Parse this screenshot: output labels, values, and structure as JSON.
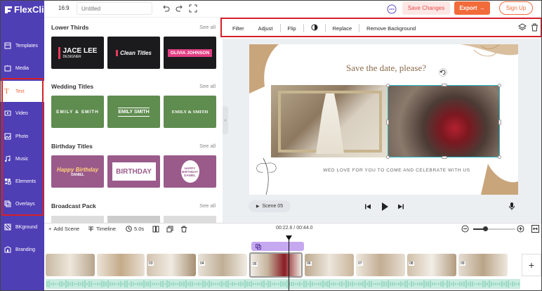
{
  "app": {
    "logo": "FlexClip",
    "aspect_ratio": "16:9",
    "title_placeholder": "Untitled"
  },
  "header": {
    "save_changes": "Save Changes",
    "export": "Export",
    "sign_up": "Sign Up"
  },
  "sidebar": {
    "items": [
      {
        "label": "Templates",
        "icon": "template-icon"
      },
      {
        "label": "Media",
        "icon": "media-icon"
      },
      {
        "label": "Text",
        "icon": "text-icon",
        "active": true
      },
      {
        "label": "Video",
        "icon": "video-icon"
      },
      {
        "label": "Photo",
        "icon": "photo-icon"
      },
      {
        "label": "Music",
        "icon": "music-icon"
      },
      {
        "label": "Elements",
        "icon": "elements-icon"
      },
      {
        "label": "Overlays",
        "icon": "overlays-icon"
      },
      {
        "label": "BKground",
        "icon": "background-icon"
      },
      {
        "label": "Branding",
        "icon": "branding-icon"
      }
    ]
  },
  "panel": {
    "sections": [
      {
        "title": "Lower Thirds",
        "see_all": "See all",
        "thumbs": [
          {
            "line1": "JACE LEE",
            "line2": "DESIGNER",
            "color": "#1b1b1d"
          },
          {
            "line1": "Clean Titles",
            "line2": "",
            "color": "#1b1b1d"
          },
          {
            "line1": "OLIVIA JOHNSON",
            "line2": "",
            "color": "#1b1b1d"
          }
        ]
      },
      {
        "title": "Wedding Titles",
        "see_all": "See all",
        "thumbs": [
          {
            "line1": "EMILY & SMITH",
            "line2": "",
            "color": "#5f8c4f"
          },
          {
            "line1": "EMILY SMITH",
            "line2": "",
            "color": "#5f8c4f"
          },
          {
            "line1": "EMILY & SMITH",
            "line2": "",
            "color": "#5f8c4f"
          }
        ]
      },
      {
        "title": "Birthday Titles",
        "see_all": "See all",
        "thumbs": [
          {
            "line1": "Happy Birthday",
            "line2": "DANIEL",
            "color": "#9a5b8b"
          },
          {
            "line1": "BIRTHDAY",
            "line2": "",
            "color": "#9a5b8b"
          },
          {
            "line1": "HAPPY BIRTHDAY",
            "line2": "DANIEL",
            "color": "#9a5b8b"
          }
        ]
      },
      {
        "title": "Broadcast Pack",
        "see_all": "See all",
        "thumbs": []
      }
    ]
  },
  "toolbar": {
    "items": [
      "Filter",
      "Adjust",
      "Flip",
      "Replace",
      "Remove Background"
    ]
  },
  "canvas": {
    "headline": "Save the date, please?",
    "subline": "WED LOVE FOR YOU TO COME AND CELEBRATE WITH US"
  },
  "player": {
    "scene_label": "Scene 05"
  },
  "timeline": {
    "add_scene": "Add Scene",
    "timeline_label": "Timeline",
    "duration": "5.0s",
    "time_readout": "00:22.6 / 00:44.0",
    "clip_numbers": [
      "01",
      "02",
      "03",
      "04",
      "05",
      "06",
      "07",
      "08",
      "09",
      "10"
    ]
  },
  "colors": {
    "brand_purple": "#4f3fb5",
    "accent_orange": "#f26b3a",
    "highlight_red": "#d5202a",
    "audio_green": "#7fd0b4"
  }
}
